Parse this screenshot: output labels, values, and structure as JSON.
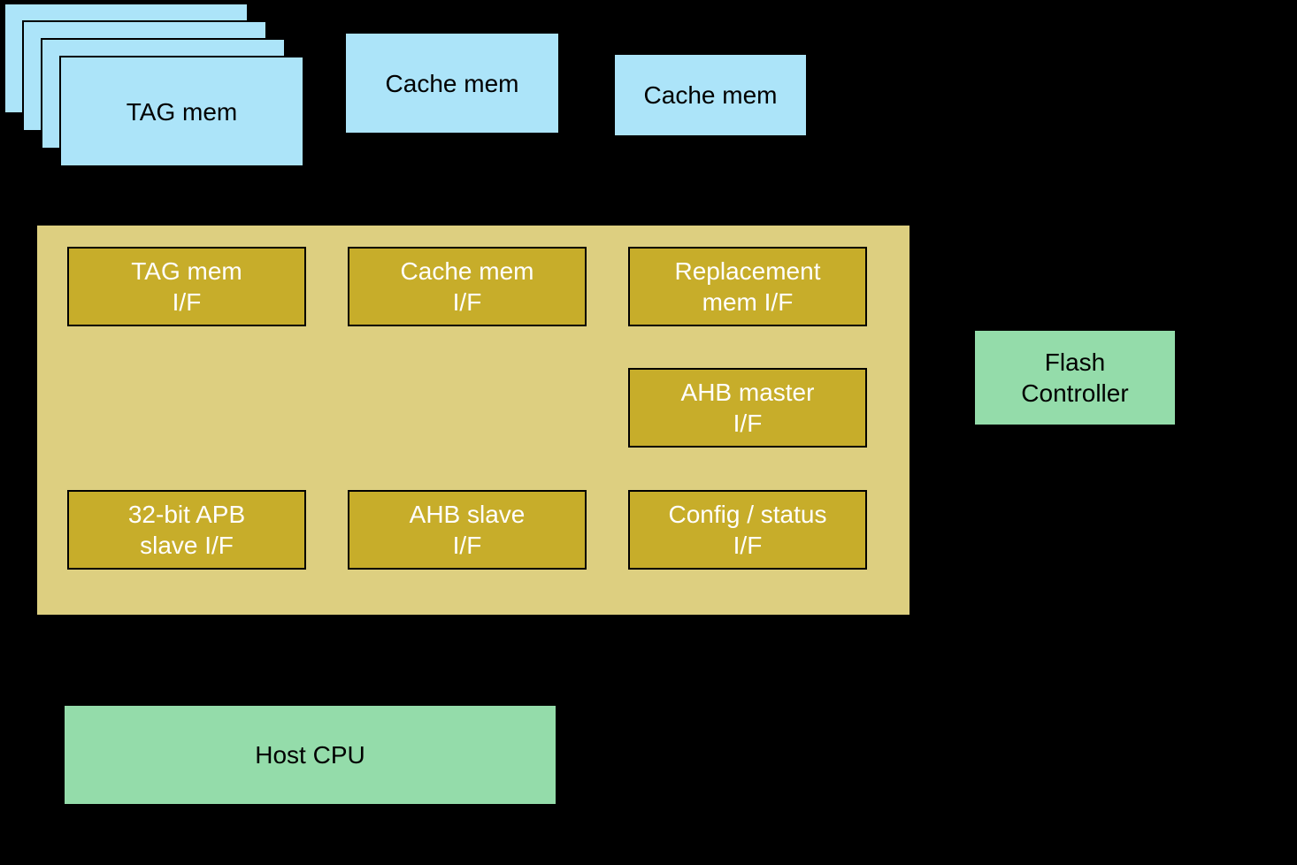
{
  "mem": {
    "tag": "TAG mem",
    "cache1": "Cache mem",
    "cache2": "Cache mem"
  },
  "controller": {
    "tag_if": "TAG mem\nI/F",
    "cache_if": "Cache mem\nI/F",
    "replacement_if": "Replacement\nmem I/F",
    "ahb_master_if": "AHB master\nI/F",
    "apb_slave_if": "32-bit APB\nslave I/F",
    "ahb_slave_if": "AHB slave\nI/F",
    "config_if": "Config / status\nI/F"
  },
  "ext": {
    "flash": "Flash\nController",
    "host": "Host CPU"
  }
}
